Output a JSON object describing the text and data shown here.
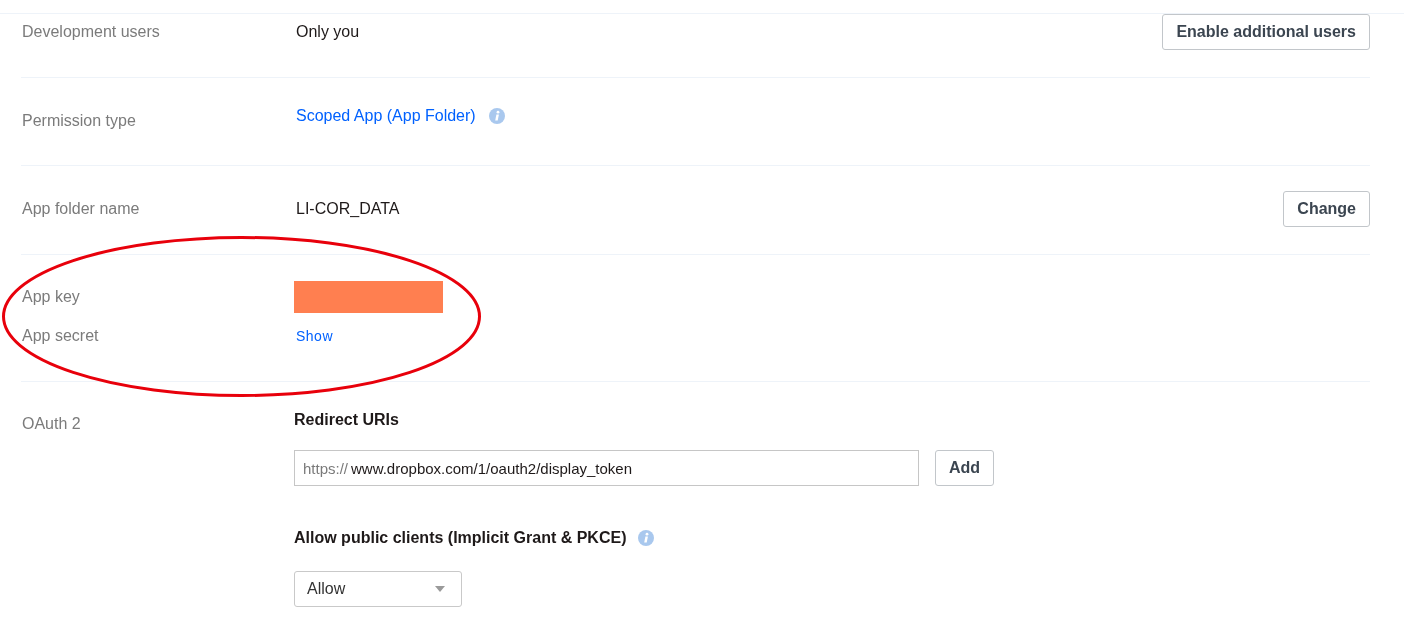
{
  "rows": [
    {
      "kind": "text",
      "label": "Development users",
      "value": "Only you",
      "button": "Enable additional users"
    },
    {
      "kind": "link",
      "label": "Permission type",
      "value": "Scoped App (App Folder)",
      "info": true
    },
    {
      "kind": "text",
      "label": "App folder name",
      "value": "LI-COR_DATA",
      "button": "Change"
    },
    {
      "kind": "keys",
      "annotation": {
        "kind": "ellipse"
      },
      "items": [
        {
          "label": "App key",
          "kind": "redacted"
        },
        {
          "label": "App secret",
          "kind": "link",
          "value": "Show"
        }
      ]
    },
    {
      "kind": "oauth",
      "label": "OAuth 2",
      "redirect": {
        "heading": "Redirect URIs",
        "prefix": "https://",
        "value": "www.dropbox.com/1/oauth2/display_token",
        "button": "Add"
      },
      "public_clients": {
        "heading": "Allow public clients (Implicit Grant & PKCE)",
        "info": true,
        "select": "Allow"
      }
    }
  ]
}
